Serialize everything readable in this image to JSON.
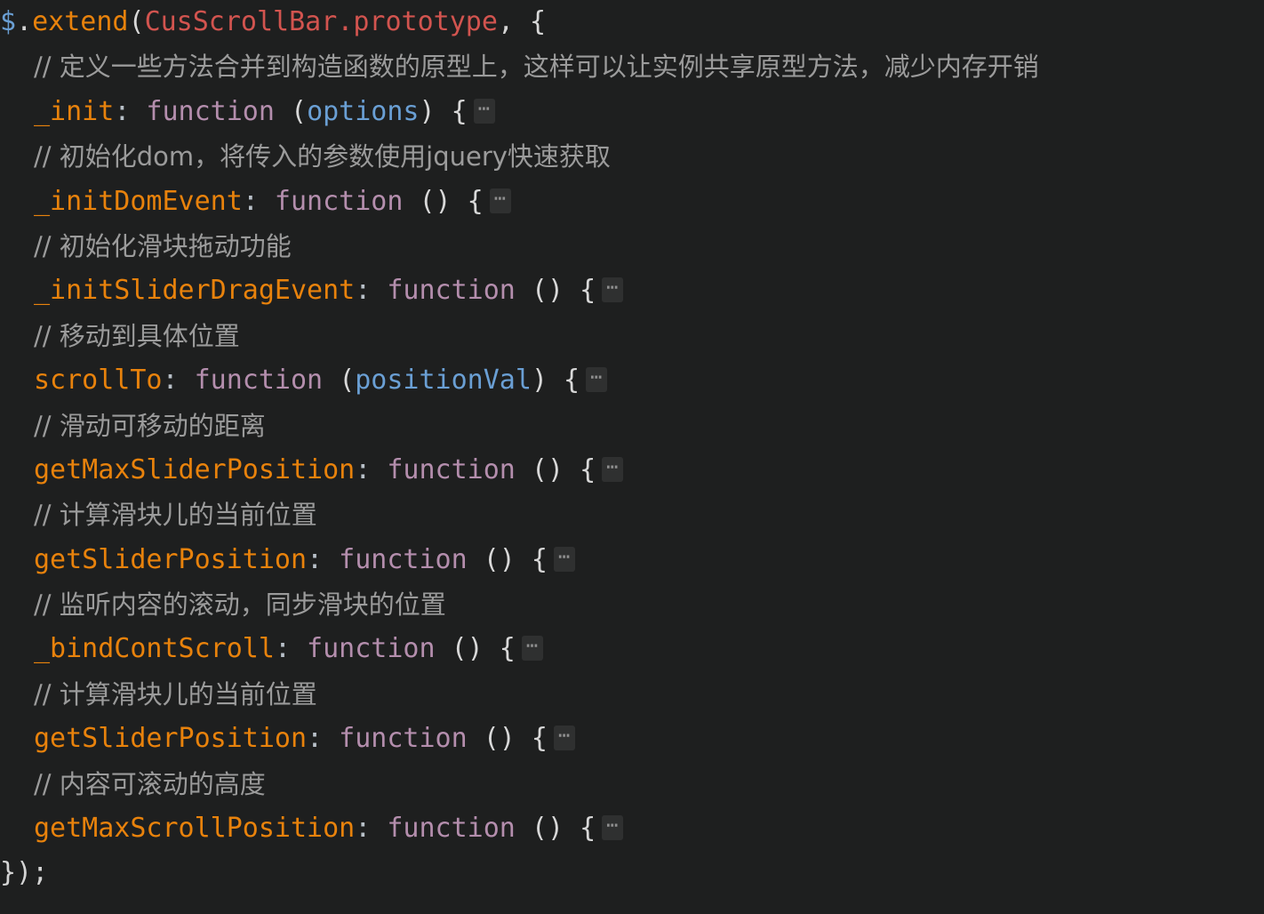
{
  "editor": {
    "language": "javascript",
    "theme": "dark",
    "background_color": "#1e1f1f",
    "fold_marker": "⋯",
    "colors": {
      "variable": "#6a9fd4",
      "function_name": "#e8820c",
      "class_name": "#d2544f",
      "keyword": "#b48ead",
      "parameter": "#6a9fd4",
      "comment": "#9b9b9b",
      "punctuation": "#d4d4d4",
      "bracket": "#d8d8d8"
    }
  },
  "code": {
    "line01": {
      "dollar": "$",
      "dot": ".",
      "extend": "extend",
      "open_paren": "(",
      "class_name": "CusScrollBar",
      "dot2": ".",
      "prototype": "prototype",
      "comma": ",",
      "open_brace": "{"
    },
    "line02_comment": "// 定义一些方法合并到构造函数的原型上，这样可以让实例共享原型方法，减少内存开销",
    "line03": {
      "name": "_init",
      "colon": ":",
      "keyword": "function",
      "open_paren": "(",
      "param": "options",
      "close_paren": ")",
      "open_brace": "{"
    },
    "line04_comment": "// 初始化dom，将传入的参数使用jquery快速获取",
    "line05": {
      "name": "_initDomEvent",
      "colon": ":",
      "keyword": "function",
      "parens": "()",
      "open_brace": "{"
    },
    "line06_comment": "// 初始化滑块拖动功能",
    "line07": {
      "name": "_initSliderDragEvent",
      "colon": ":",
      "keyword": "function",
      "parens": "()",
      "open_brace": "{"
    },
    "line08_comment": "// 移动到具体位置",
    "line09": {
      "name": "scrollTo",
      "colon": ":",
      "keyword": "function",
      "open_paren": "(",
      "param": "positionVal",
      "close_paren": ")",
      "open_brace": "{"
    },
    "line10_comment": "// 滑动可移动的距离",
    "line11": {
      "name": "getMaxSliderPosition",
      "colon": ":",
      "keyword": "function",
      "parens": "()",
      "open_brace": "{"
    },
    "line12_comment": "// 计算滑块儿的当前位置",
    "line13": {
      "name": "getSliderPosition",
      "colon": ":",
      "keyword": "function",
      "parens": "()",
      "open_brace": "{"
    },
    "line14_comment": "// 监听内容的滚动，同步滑块的位置",
    "line15": {
      "name": "_bindContScroll",
      "colon": ":",
      "keyword": "function",
      "parens": "()",
      "open_brace": "{"
    },
    "line16_comment": "// 计算滑块儿的当前位置",
    "line17": {
      "name": "getSliderPosition",
      "colon": ":",
      "keyword": "function",
      "parens": "()",
      "open_brace": "{"
    },
    "line18_comment": "// 内容可滚动的高度",
    "line19": {
      "name": "getMaxScrollPosition",
      "colon": ":",
      "keyword": "function",
      "parens": "()",
      "open_brace": "{"
    },
    "line20_close": "});"
  }
}
